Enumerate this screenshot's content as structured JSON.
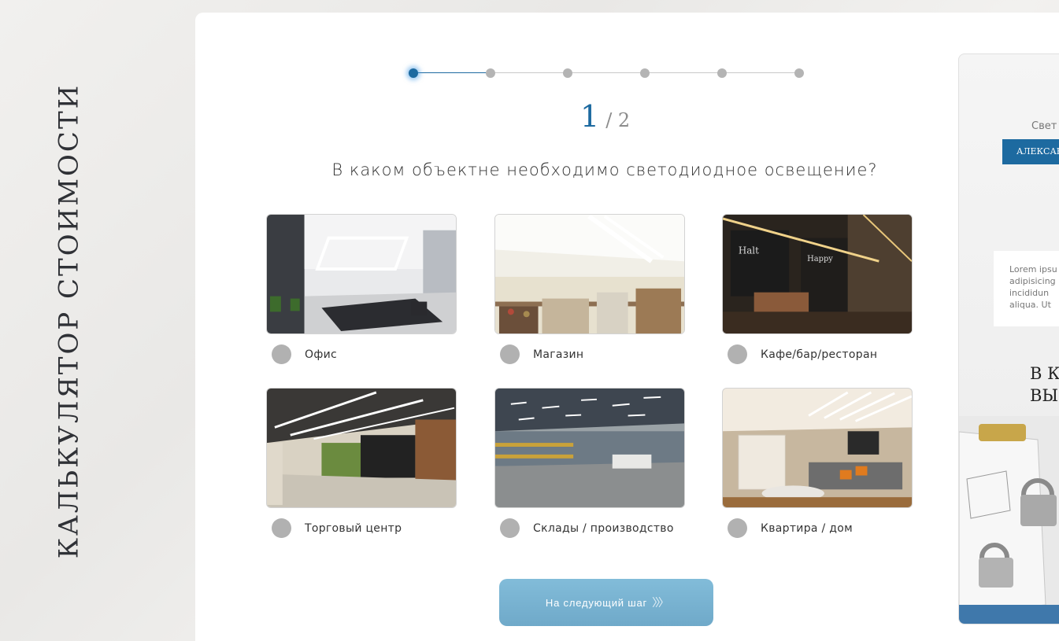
{
  "page_title": "КАЛЬКУЛЯТОР СТОИМОСТИ",
  "stepper": {
    "step_count": 6,
    "active_index": 0
  },
  "counter": {
    "current": "1",
    "total": "/ 2"
  },
  "question": "В каком объектне необходимо светодиодное освещение?",
  "options": [
    {
      "label": "Офис",
      "image": "office-photo"
    },
    {
      "label": "Магазин",
      "image": "shop-photo"
    },
    {
      "label": "Кафе/бар/ресторан",
      "image": "cafe-photo"
    },
    {
      "label": "Торговый центр",
      "image": "mall-photo"
    },
    {
      "label": "Склады / производство",
      "image": "warehouse-photo"
    },
    {
      "label": "Квартира / дом",
      "image": "apartment-photo"
    }
  ],
  "next_button": {
    "label": "На следующий шаг",
    "icon": "chevrons-right-icon"
  },
  "side_panel": {
    "small_text": "Свет",
    "badge": "АЛЕКСАН",
    "note": "Lorem ipsu\nadipisicing\nincididun\naliqua. Ut",
    "big_text": "В К\nВЫ"
  },
  "colors": {
    "accent": "#1d6aa0",
    "button": "#78b3d2",
    "radio": "#b1b1b1"
  }
}
